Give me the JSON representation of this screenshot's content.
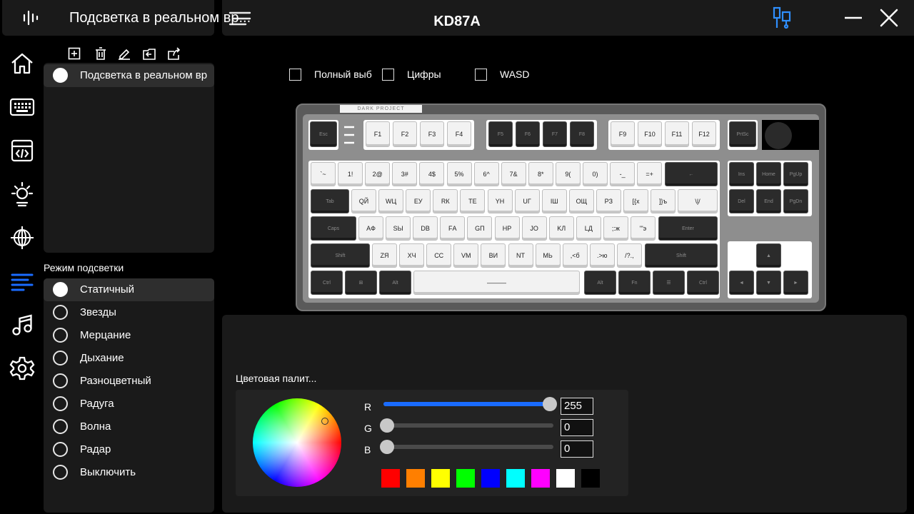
{
  "app": {
    "title": "Подсветка в реальном вр...",
    "device": "KD87A"
  },
  "profiles": {
    "items": [
      {
        "label": "Подсветка в реальном вр"
      }
    ]
  },
  "checkboxes": [
    {
      "label": "Полный выб"
    },
    {
      "label": "Цифры"
    },
    {
      "label": "WASD"
    }
  ],
  "modes": {
    "title": "Режим подсветки",
    "items": [
      {
        "label": "Статичный",
        "selected": true
      },
      {
        "label": "Звезды"
      },
      {
        "label": "Мерцание"
      },
      {
        "label": "Дыхание"
      },
      {
        "label": "Разноцветный"
      },
      {
        "label": "Радуга"
      },
      {
        "label": "Волна"
      },
      {
        "label": "Радар"
      },
      {
        "label": "Выключить"
      }
    ]
  },
  "keyboard": {
    "brand": "DARK PROJECT",
    "rows": {
      "fn": [
        "Esc",
        "F1",
        "F2",
        "F3",
        "F4",
        "F5",
        "F6",
        "F7",
        "F8",
        "F9",
        "F10",
        "F11",
        "F12",
        "PrtSc"
      ],
      "num": [
        "`~",
        "1!",
        "2@",
        "3#",
        "4$",
        "5%",
        "6^",
        "7&",
        "8*",
        "9(",
        "0)",
        "-_",
        "=+",
        "←",
        "Ins",
        "Home",
        "PgUp"
      ],
      "top": [
        "Tab",
        "QЙ",
        "WЦ",
        "EУ",
        "RК",
        "TЕ",
        "YН",
        "UГ",
        "IШ",
        "OЩ",
        "PЗ",
        "[{х",
        "]}ъ",
        "\\|/",
        "Del",
        "End",
        "PgDn"
      ],
      "home": [
        "Caps",
        "AФ",
        "SЫ",
        "DВ",
        "FА",
        "GП",
        "HР",
        "JО",
        "KЛ",
        "LД",
        ";:ж",
        "'\"э",
        "Enter"
      ],
      "shift": [
        "Shift",
        "ZЯ",
        "XЧ",
        "CС",
        "VМ",
        "BИ",
        "NТ",
        "MЬ",
        ",<б",
        ".>ю",
        "/?.,",
        "Shift",
        "▲"
      ],
      "bottom": [
        "Ctrl",
        "⊞",
        "Alt",
        "———",
        "Alt",
        "Fn",
        "☰",
        "Ctrl",
        "◄",
        "▼",
        "►"
      ]
    }
  },
  "palette": {
    "title": "Цветовая палит...",
    "r": {
      "label": "R",
      "value": "255",
      "level": 1.0
    },
    "g": {
      "label": "G",
      "value": "0",
      "level": 0.0
    },
    "b": {
      "label": "B",
      "value": "0",
      "level": 0.0
    },
    "swatches": [
      "#ff0000",
      "#ff7f00",
      "#ffff00",
      "#00ff00",
      "#0000ff",
      "#00ffff",
      "#ff00ff",
      "#ffffff",
      "#000000"
    ],
    "accent": "#1a6cff"
  },
  "icons": {
    "logo": "logo-icon",
    "menu": "hamburger-icon",
    "device": "usb-device-icon",
    "minimize": "minimize-icon",
    "close": "close-icon"
  }
}
